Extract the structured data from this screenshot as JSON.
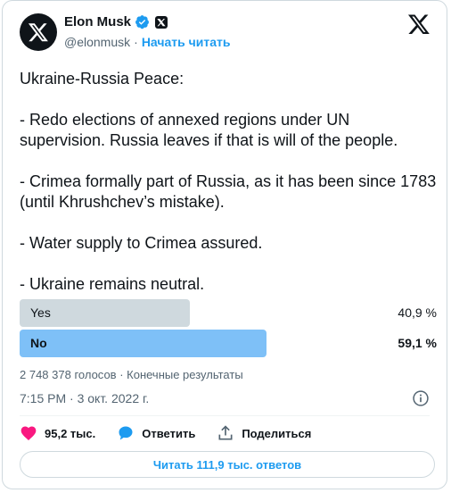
{
  "author": {
    "name": "Elon Musk",
    "handle": "@elonmusk",
    "separator": "·",
    "follow_label": "Начать читать"
  },
  "tweet": {
    "text": "Ukraine-Russia Peace:\n\n- Redo elections of annexed regions under UN supervision. Russia leaves if that is will of the people.\n\n- Crimea formally part of Russia, as it has been since 1783 (until Khrushchev’s mistake).\n\n- Water supply to Crimea assured.\n\n- Ukraine remains neutral."
  },
  "poll": {
    "options": [
      {
        "label": "Yes",
        "percent_text": "40,9 %",
        "percent": 40.9,
        "winner": false
      },
      {
        "label": "No",
        "percent_text": "59,1 %",
        "percent": 59.1,
        "winner": true
      }
    ],
    "summary": "2 748 378 голосов · Конечные результаты"
  },
  "timestamp": "7:15 PM · 3 окт. 2022 г.",
  "actions": {
    "likes": "95,2 тыс.",
    "reply_label": "Ответить",
    "share_label": "Поделиться"
  },
  "read_replies_label": "Читать 111,9 тыс. ответов",
  "colors": {
    "accent": "#1d9bf0",
    "like": "#f91880",
    "poll_winner": "#7ec0f7",
    "poll_other": "#cfd9de"
  },
  "icons": [
    "x-avatar-icon",
    "verified-badge-icon",
    "x-affiliate-icon",
    "x-logo-icon",
    "info-icon",
    "heart-icon",
    "reply-icon",
    "share-icon"
  ]
}
